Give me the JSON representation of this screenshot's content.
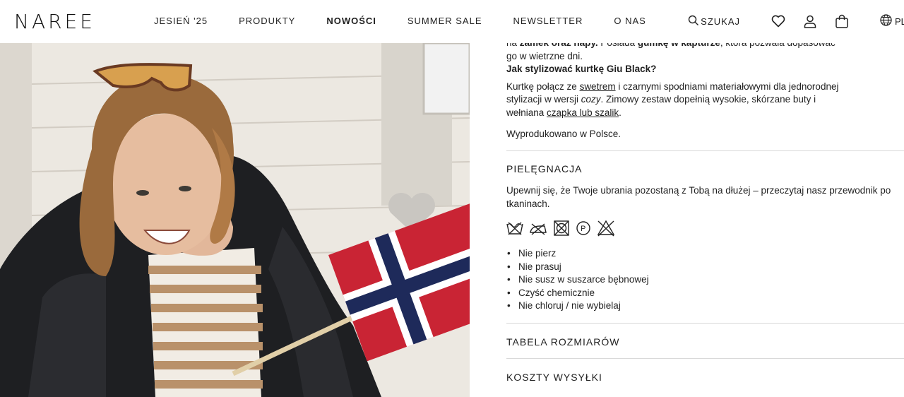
{
  "header": {
    "logo": "NAREE",
    "nav": [
      {
        "label": "JESIEŃ '25",
        "active": false
      },
      {
        "label": "PRODUKTY",
        "active": false
      },
      {
        "label": "NOWOŚCI",
        "active": true
      },
      {
        "label": "SUMMER SALE",
        "active": false
      },
      {
        "label": "NEWSLETTER",
        "active": false
      },
      {
        "label": "O NAS",
        "active": false
      }
    ],
    "search_label": "SZUKAJ",
    "lang_label": "PL",
    "icons": [
      "search-icon",
      "heart-icon",
      "user-icon",
      "bag-icon",
      "globe-icon"
    ]
  },
  "product": {
    "desc_intro_plain1": "na ",
    "desc_intro_bold1": "zamek oraz napy.",
    "desc_intro_plain2": " Posiada ",
    "desc_intro_bold2": "gumkę w kapturze",
    "desc_intro_plain3": ", która pozwala dopasować go w wietrzne dni.",
    "style_heading": "Jak stylizować kurtkę Giu Black?",
    "style_p1": "Kurtkę połącz ze ",
    "style_link1": "swetrem",
    "style_p2": " i czarnymi spodniami materiałowymi dla jednorodnej stylizacji w wersji ",
    "style_em": "cozy",
    "style_p3": ". Zimowy zestaw dopełnią wysokie, skórzane buty i wełniana ",
    "style_link2": "czapka lub szalik",
    "style_p4": ".",
    "made_in": "Wyprodukowano w Polsce."
  },
  "care": {
    "title": "PIELĘGNACJA",
    "text": "Upewnij się, że Twoje ubrania pozostaną z Tobą na dłużej – przeczytaj nasz przewodnik po tkaninach.",
    "icons": [
      "do-not-wash-icon",
      "do-not-iron-icon",
      "do-not-tumble-dry-icon",
      "dry-clean-p-icon",
      "do-not-bleach-icon"
    ],
    "items": [
      "Nie pierz",
      "Nie prasuj",
      "Nie susz w suszarce bębnowej",
      "Czyść chemicznie",
      "Nie chloruj / nie wybielaj"
    ]
  },
  "sections": {
    "size_table": "TABELA ROZMIARÓW",
    "shipping": "KOSZTY WYSYŁKI"
  }
}
